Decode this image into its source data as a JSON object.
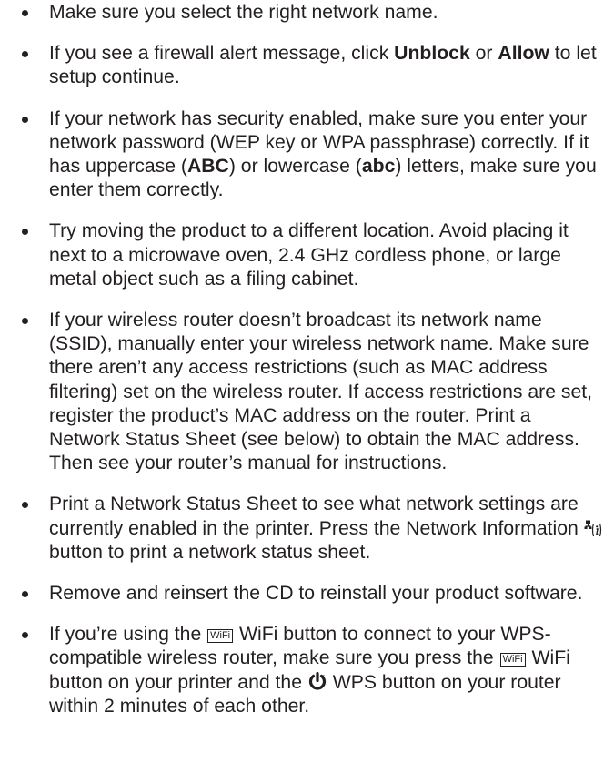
{
  "bullets": [
    {
      "text": "Make sure you select the right network name."
    },
    {
      "t1": "If you see a firewall alert message, click ",
      "b1": "Unblock",
      "t2": " or ",
      "b2": "Allow",
      "t3": " to let setup continue."
    },
    {
      "t1": "If your network has security enabled, make sure you enter your network password (WEP key or WPA passphrase) correctly. If it has uppercase (",
      "b1": "ABC",
      "t2": ") or lowercase (",
      "b2": "abc",
      "t3": ") letters, make sure you enter them correctly."
    },
    {
      "text": "Try moving the product to a different location. Avoid placing it next to a microwave oven, 2.4 GHz cordless phone, or large metal object such as a filing cabinet."
    },
    {
      "text": "If your wireless router doesn’t broadcast its network name (SSID), manually enter your wireless network name. Make sure there aren’t any access restrictions (such as MAC address filtering) set on the wireless router. If access restrictions are set, register the product’s MAC address on the router. Print a Network Status Sheet (see below) to obtain the MAC address. Then see your router’s manual for instructions."
    },
    {
      "t1": "Print a Network Status Sheet to see what network settings are currently enabled in the printer. Press the Network Information ",
      "t2": " button to print a network status sheet."
    },
    {
      "text": "Remove and reinsert the CD to reinstall your product software."
    },
    {
      "t1": "If you’re using the ",
      "wifi_label": "WiFi",
      "t2": " WiFi button to connect to your WPS-compatible wireless router, make sure you press the ",
      "t3": " WiFi button on your printer and the ",
      "t4": " WPS button on your router within 2 minutes of each other."
    }
  ],
  "icons": {
    "network_info": "network-information-icon",
    "wifi": "wifi-button-icon",
    "wps": "wps-icon"
  }
}
